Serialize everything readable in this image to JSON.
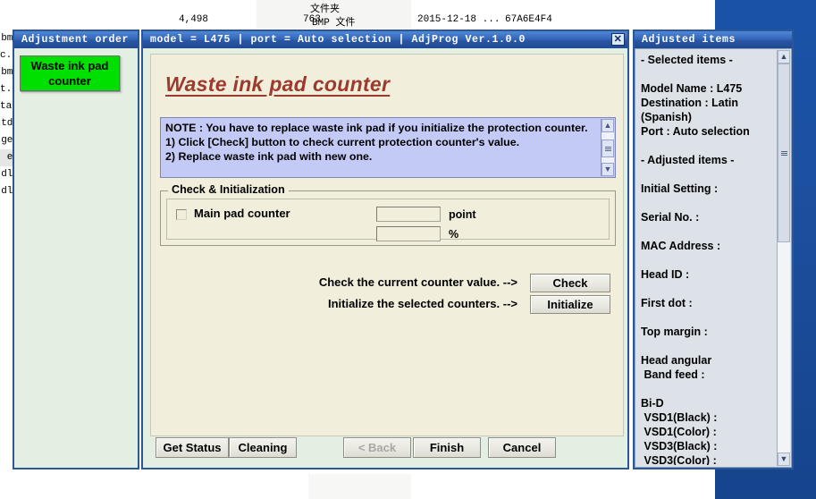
{
  "background": {
    "file_row": {
      "size": "4,498",
      "number": "763",
      "type": "BMP 文件",
      "date": "2015-12-18 ...",
      "hash": "67A6E4F4"
    },
    "folder_label": "文件夹",
    "left_names": [
      "bmp",
      "c. bu",
      "bmp",
      "t. d",
      "tail",
      "tda",
      "ge. ",
      "ex",
      "dll",
      "dll"
    ]
  },
  "left_window": {
    "title": "Adjustment order",
    "button_label": "Waste ink pad counter"
  },
  "main_window": {
    "title": "model = L475 | port = Auto selection | AdjProg Ver.1.0.0",
    "close_label": "✕",
    "heading": "Waste ink pad counter",
    "note": "NOTE : You have to replace waste ink pad if you initialize the protection counter.\n1) Click [Check] button to check current protection counter's value.\n2) Replace waste ink pad with new one.",
    "group": {
      "legend": "Check & Initialization",
      "checkbox_label": "Main pad counter",
      "checkbox_checked": false,
      "point_value": "",
      "point_unit": "point",
      "percent_value": "",
      "percent_unit": "%"
    },
    "actions": {
      "check_label": "Check the current counter value. -->",
      "check_button": "Check",
      "initialize_label": "Initialize the selected counters. -->",
      "initialize_button": "Initialize"
    },
    "footer": {
      "get_status": "Get Status",
      "cleaning": "Cleaning",
      "back": "< Back",
      "back_disabled": true,
      "finish": "Finish",
      "cancel": "Cancel"
    },
    "scrollbar": {
      "up": "▲",
      "down": "▼"
    }
  },
  "right_window": {
    "title": "Adjusted items",
    "content": "- Selected items -\n\nModel Name : L475\nDestination : Latin\n(Spanish)\nPort : Auto selection\n\n- Adjusted items -\n\nInitial Setting :\n\nSerial No. :\n\nMAC Address :\n\nHead ID :\n\nFirst dot :\n\nTop margin :\n\nHead angular\n Band feed :\n\nBi-D\n VSD1(Black) :\n VSD1(Color) :\n VSD3(Black) :\n VSD3(Color) :",
    "scrollbar": {
      "up": "▲",
      "down": "▼"
    }
  },
  "colors": {
    "accent_blue": "#2b5797",
    "desktop_blue": "#1a52a8",
    "panel_cream": "#f2eedc",
    "panel_green": "#e4efe4",
    "note_lavender": "#c3caf6",
    "heading_red": "#9c3a2e",
    "button_green": "#00e000"
  }
}
